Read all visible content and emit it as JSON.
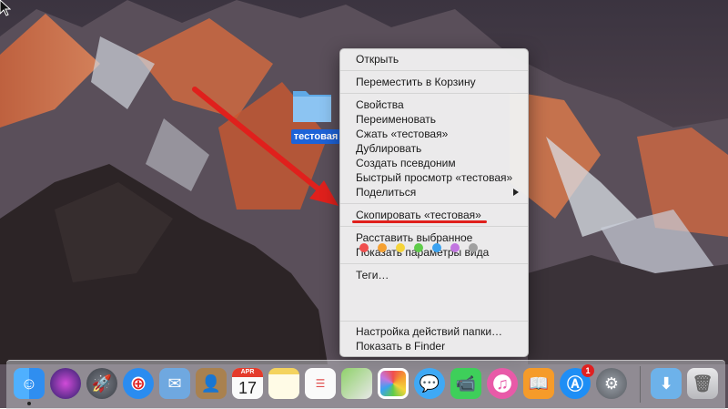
{
  "desktop": {
    "wallpaper": "mountain-sierra",
    "folder_label": "тестовая"
  },
  "context_menu": {
    "items": [
      {
        "label": "Открыть"
      },
      {
        "label": "Переместить в Корзину"
      },
      {
        "label": "Свойства"
      },
      {
        "label": "Переименовать"
      },
      {
        "label": "Сжать «тестовая»"
      },
      {
        "label": "Дублировать"
      },
      {
        "label": "Создать псевдоним"
      },
      {
        "label": "Быстрый просмотр «тестовая»"
      },
      {
        "label": "Поделиться"
      },
      {
        "label": "Скопировать «тестовая»"
      },
      {
        "label": "Расставить выбранное"
      },
      {
        "label": "Показать параметры вида"
      },
      {
        "label": "Теги…"
      },
      {
        "label": "Настройка действий папки…"
      },
      {
        "label": "Показать в Finder"
      }
    ],
    "tag_colors": [
      "#f04e4e",
      "#f5a030",
      "#f5d43a",
      "#5fcc4a",
      "#3aa2f0",
      "#c276e0",
      "#a0a0a0"
    ]
  },
  "annotation": {
    "arrow_color": "#e0201c"
  },
  "dock": {
    "icons": [
      {
        "name": "finder-icon"
      },
      {
        "name": "siri-icon"
      },
      {
        "name": "launchpad-icon"
      },
      {
        "name": "safari-icon"
      },
      {
        "name": "mail-icon"
      },
      {
        "name": "contacts-icon"
      },
      {
        "name": "calendar-icon",
        "month": "APR",
        "day": "17"
      },
      {
        "name": "notes-icon"
      },
      {
        "name": "reminders-icon"
      },
      {
        "name": "maps-icon"
      },
      {
        "name": "photos-icon"
      },
      {
        "name": "messages-icon"
      },
      {
        "name": "facetime-icon"
      },
      {
        "name": "itunes-icon"
      },
      {
        "name": "ibooks-icon"
      },
      {
        "name": "app-store-icon",
        "badge": "1"
      },
      {
        "name": "system-preferences-icon"
      },
      {
        "name": "downloads-folder-icon"
      },
      {
        "name": "trash-icon"
      }
    ]
  }
}
